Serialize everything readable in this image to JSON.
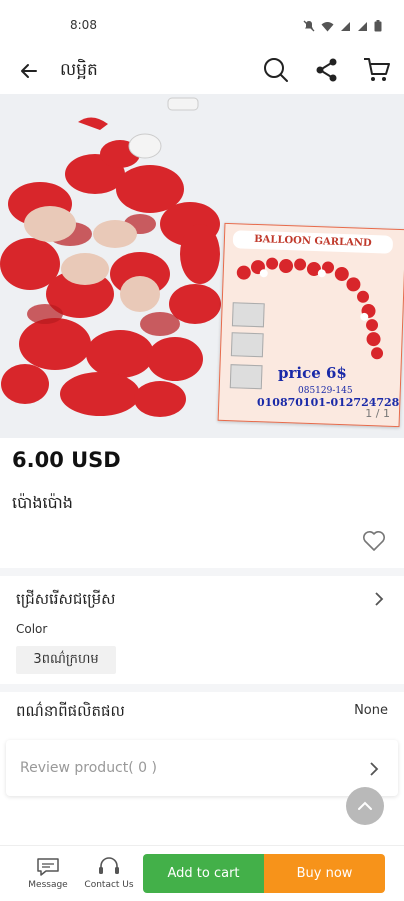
{
  "status_bar": {
    "time": "8:08"
  },
  "app_bar": {
    "title": "លម្អិត"
  },
  "hero": {
    "poster_title": "BALLOON GARLAND",
    "price_text": "price 6$",
    "code_text": "085129-145",
    "phones_text": "010870101-012724728",
    "counter": "1 / 1"
  },
  "product": {
    "price": "6.00 USD",
    "name": "ប៉េាងប៉ោង"
  },
  "options": {
    "title": "ជ្រើសរើសជម្រើស",
    "color_label": "Color",
    "color_value": "3ពណ៌ក្រហម"
  },
  "origin": {
    "label": "ពណ៌នាពីផលិតផល",
    "value": "None"
  },
  "review": {
    "label": "Review product( 0 )"
  },
  "bottom_bar": {
    "message": "Message",
    "contact": "Contact Us",
    "add_to_cart": "Add to cart",
    "buy_now": "Buy now"
  },
  "colors": {
    "add_to_cart": "#43b049",
    "buy_now": "#f7931a",
    "balloon": "#d8262b"
  }
}
